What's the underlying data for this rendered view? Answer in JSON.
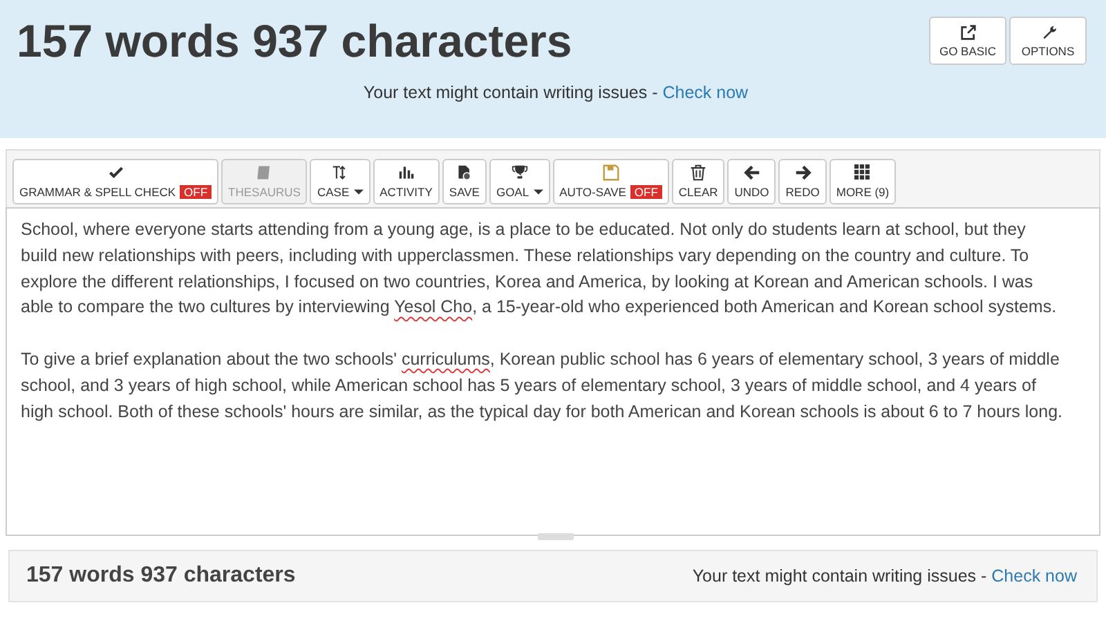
{
  "header": {
    "title": "157 words 937 characters",
    "buttons": [
      {
        "label": "GO BASIC"
      },
      {
        "label": "OPTIONS"
      }
    ],
    "notice": "Your text might contain writing issues - ",
    "notice_link": "Check now"
  },
  "toolbar": [
    {
      "label": "GRAMMAR & SPELL CHECK",
      "badge": "OFF",
      "disabled": false,
      "has_menu": false
    },
    {
      "label": "THESAURUS",
      "disabled": true,
      "has_menu": false
    },
    {
      "label": "CASE",
      "disabled": false,
      "has_menu": true
    },
    {
      "label": "ACTIVITY",
      "disabled": false,
      "has_menu": false
    },
    {
      "label": "SAVE",
      "disabled": false,
      "has_menu": false
    },
    {
      "label": "GOAL",
      "disabled": false,
      "has_menu": true
    },
    {
      "label": "AUTO-SAVE",
      "badge": "OFF",
      "disabled": false,
      "has_menu": false
    },
    {
      "label": "CLEAR",
      "disabled": false,
      "has_menu": false
    },
    {
      "label": "UNDO",
      "disabled": false,
      "has_menu": false
    },
    {
      "label": "REDO",
      "disabled": false,
      "has_menu": false
    },
    {
      "label": "MORE (9)",
      "disabled": false,
      "has_menu": false
    }
  ],
  "editor": {
    "paragraphs": [
      [
        {
          "text": "School, where everyone starts attending from a young age, is a place to be educated. Not only do students learn at school, but they build new relationships with peers, including with upperclassmen. These relationships vary depending on the country and culture. To explore the different relationships, I focused on two countries, Korea and America, by looking at Korean and American schools. I was able to compare the two cultures by interviewing ",
          "misspelled": false
        },
        {
          "text": "Yesol Cho",
          "misspelled": true
        },
        {
          "text": ", a 15-year-old who experienced both American and Korean school systems.",
          "misspelled": false
        }
      ],
      [
        {
          "text": "To give a brief explanation about the two schools' ",
          "misspelled": false
        },
        {
          "text": "curriculums",
          "misspelled": true
        },
        {
          "text": ", Korean public school has 6 years of elementary school, 3 years of middle school, and 3 years of high school, while American school has 5 years of elementary school, 3 years of middle school, and 4 years of high school. Both of these schools' hours are similar, as the typical day for both American and Korean schools is about 6 to 7 hours long.",
          "misspelled": false
        }
      ]
    ]
  },
  "footer": {
    "count": "157 words 937 characters",
    "notice": "Your text might contain writing issues - ",
    "notice_link": "Check now"
  }
}
